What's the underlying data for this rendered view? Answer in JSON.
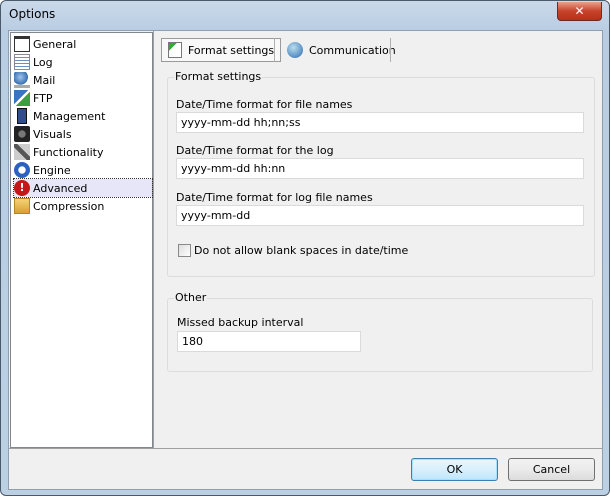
{
  "window": {
    "title": "Options",
    "close": "✕"
  },
  "sidebar": {
    "items": [
      {
        "label": "General",
        "icon": "window-icon"
      },
      {
        "label": "Log",
        "icon": "notepad-icon"
      },
      {
        "label": "Mail",
        "icon": "mail-icon"
      },
      {
        "label": "FTP",
        "icon": "network-icon"
      },
      {
        "label": "Management",
        "icon": "device-icon"
      },
      {
        "label": "Visuals",
        "icon": "camera-icon"
      },
      {
        "label": "Functionality",
        "icon": "tools-icon"
      },
      {
        "label": "Engine",
        "icon": "gear-icon"
      },
      {
        "label": "Advanced",
        "icon": "warning-icon",
        "selected": true
      },
      {
        "label": "Compression",
        "icon": "folder-icon"
      }
    ]
  },
  "tabs": [
    {
      "label": "Format settings",
      "active": true
    },
    {
      "label": "Communication"
    }
  ],
  "format": {
    "group": "Format settings",
    "file_names_label": "Date/Time format for file names",
    "file_names_value": "yyyy-mm-dd hh;nn;ss",
    "log_label": "Date/Time format for the log",
    "log_value": "yyyy-mm-dd hh:nn",
    "log_file_label": "Date/Time format for log file names",
    "log_file_value": "yyyy-mm-dd",
    "blank_label": "Do not allow blank spaces in date/time",
    "blank_checked": false
  },
  "other": {
    "group": "Other",
    "missed_label": "Missed backup interval",
    "missed_value": "180"
  },
  "buttons": {
    "ok": "OK",
    "cancel": "Cancel"
  }
}
